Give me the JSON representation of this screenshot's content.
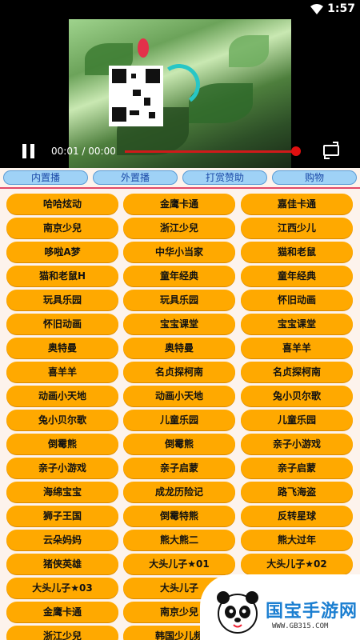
{
  "status_bar": {
    "time": "1:57"
  },
  "player": {
    "time_text": "00:01 / 00:00"
  },
  "tabs": [
    "内置播",
    "外置播",
    "打赏赞助",
    "购物"
  ],
  "items": [
    "哈哈炫动",
    "金鹰卡通",
    "嘉佳卡通",
    "南京少兒",
    "浙江少兒",
    "江西少儿",
    "哆啦A梦",
    "中华小当家",
    "猫和老鼠",
    "猫和老鼠H",
    "童年经典",
    "童年经典",
    "玩具乐园",
    "玩具乐园",
    "怀旧动画",
    "怀旧动画",
    "宝宝课堂",
    "宝宝课堂",
    "奥特曼",
    "奥特曼",
    "喜羊羊",
    "喜羊羊",
    "名贞探柯南",
    "名贞探柯南",
    "动画小天地",
    "动画小天地",
    "兔小贝尔歌",
    "兔小贝尔歌",
    "儿童乐园",
    "儿童乐园",
    "倒霉熊",
    "倒霉熊",
    "亲子小游戏",
    "亲子小游戏",
    "亲子启蒙",
    "亲子启蒙",
    "海绵宝宝",
    "成龙历险记",
    "路飞海盗",
    "狮子王国",
    "倒霉特熊",
    "反转星球",
    "云朵妈妈",
    "熊大熊二",
    "熊大过年",
    "猪侠英雄",
    "大头儿子★01",
    "大头儿子★02",
    "大头儿子★03",
    "大头儿子",
    "",
    "金鹰卡通",
    "南京少兒",
    "",
    "浙江少兒",
    "韩国少儿频",
    ""
  ],
  "watermark": {
    "name": "国宝手游网",
    "url": "WWW.GB315.COM"
  },
  "colors": {
    "button": "#ffa900",
    "tab": "#9fd2f6",
    "progress": "#d01a1a",
    "spinner": "#27c6c6"
  }
}
